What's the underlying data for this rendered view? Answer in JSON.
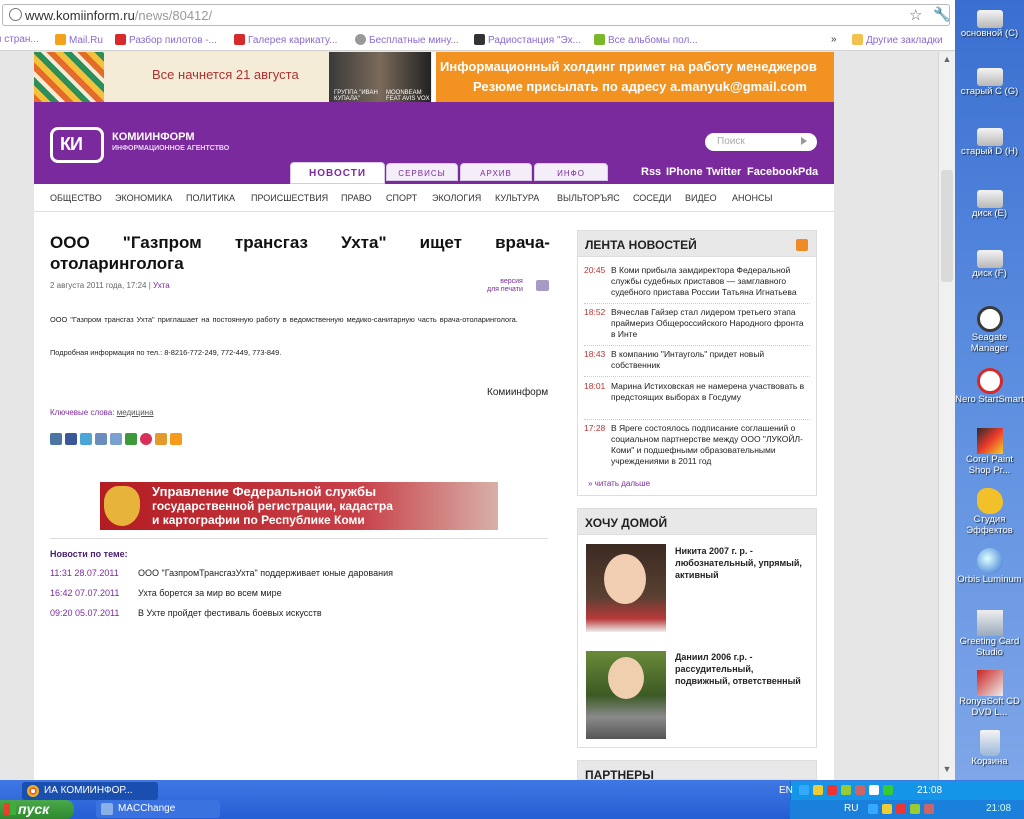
{
  "browser": {
    "url_host": "www.komiinform.ru",
    "url_path": "/news/80412/",
    "bookmarks": [
      {
        "label": "я стран..."
      },
      {
        "label": "Mail.Ru"
      },
      {
        "label": "Разбор пилотов -..."
      },
      {
        "label": "Галерея карикату..."
      },
      {
        "label": "Бесплатные мину..."
      },
      {
        "label": "Радиостанция \"Эх..."
      },
      {
        "label": "Все альбомы пол..."
      }
    ],
    "bookmarks_more": "»",
    "other_bookmarks": "Другие закладки"
  },
  "banners": {
    "top_left_text": "Все начнется 21 августа",
    "top_left_label1": "ГРУППА \"ИВАН КУПАЛА\"",
    "top_left_label2": "MOONBEAM FEAT AVIS VOX",
    "top_right_line1": "Информационный холдинг примет на работу менеджеров",
    "top_right_line2": "Резюме присылать по адресу a.manyuk@gmail.com",
    "mid_line1": "Управление Федеральной службы",
    "mid_line2": "государственной регистрации, кадастра",
    "mid_line3": "и картографии по Республике Коми"
  },
  "header": {
    "logo_text": "КИ",
    "brand": "КОМИИНФОРМ",
    "brand_sub": "ИНФОРМАЦИОННОЕ АГЕНТСТВО",
    "search_placeholder": "Поиск",
    "tabs": [
      "НОВОСТИ",
      "СЕРВИСЫ",
      "АРХИВ",
      "ИНФО"
    ],
    "links": [
      "Rss",
      "IPhone",
      "Twitter",
      "Facebook",
      "Pda"
    ]
  },
  "nav": [
    "ОБЩЕСТВО",
    "ЭКОНОМИКА",
    "ПОЛИТИКА",
    "ПРОИСШЕСТВИЯ",
    "ПРАВО",
    "СПОРТ",
    "ЭКОЛОГИЯ",
    "КУЛЬТУРА",
    "ВЫЛЬТОРЪЯС",
    "СОСЕДИ",
    "ВИДЕО",
    "АНОНСЫ"
  ],
  "article": {
    "title_w1": "ООО",
    "title_w2": "\"Газпром",
    "title_w3": "трансгаз",
    "title_w4": "Ухта\"",
    "title_w5": "ищет",
    "title_w6": "врача-",
    "title_line2": "отоларинголога",
    "date": "2 августа 2011 года, 17:24 |",
    "place": "Ухта",
    "print_label_1": "версия",
    "print_label_2": "для печати",
    "para1": "ООО \"Газпром трансгаз Ухта\" приглашает на постоянную работу в ведомственную медико-санитарную часть врача-отоларинголога.",
    "para2": "Подробная информация по тел.: 8-8216-772-249, 772-449, 773-849.",
    "source": "Коми­информ",
    "keywords_label": "Ключевые слова:",
    "keywords_value": "медицина"
  },
  "related": {
    "heading": "Новости по теме:",
    "items": [
      {
        "time": "11:31 28.07.2011",
        "text": "ООО \"ГазпромТрансгазУхта\" поддерживает юные дарования"
      },
      {
        "time": "16:42 07.07.2011",
        "text": "Ухта борется за мир во всем мире"
      },
      {
        "time": "09:20 05.07.2011",
        "text": "В Ухте пройдет фестиваль боевых искусств"
      }
    ]
  },
  "feed": {
    "heading": "ЛЕНТА НОВОСТЕЙ",
    "items": [
      {
        "time": "20:45",
        "text": "В Коми прибыла замдиректора Федеральной службы судебных приставов — замглавного судебного пристава России Татьяна Игнатьева"
      },
      {
        "time": "18:52",
        "text": "Вячеслав Гайзер стал лидером третьего этапа праймериз Общероссийского Народного фронта в Инте"
      },
      {
        "time": "18:43",
        "text": "В компанию \"Интауголь\" придет новый собственник"
      },
      {
        "time": "18:01",
        "text": "Марина Истиховская не намерена участвовать в предстоящих выборах в Госдуму"
      },
      {
        "time": "17:28",
        "text": "В Яреге состоялось подписание соглашений о социальном партнерстве между ООО \"ЛУКОЙЛ-Коми\" и подшефными образовательными учреждениями в 2011 год"
      }
    ],
    "more": "» читать дальше"
  },
  "home": {
    "heading": "ХОЧУ ДОМОЙ",
    "kids": [
      {
        "text": "Никита 2007 г. р. - любознательный, упрямый, активный"
      },
      {
        "text": "Даниил 2006 г.р. - рассудительный, подвижный, ответственный"
      }
    ]
  },
  "partners": {
    "heading": "ПАРТНЕРЫ"
  },
  "desktop": {
    "icons": [
      {
        "label": "основной (C)"
      },
      {
        "label": "старый C (G)"
      },
      {
        "label": "старый D (H)"
      },
      {
        "label": "диск (E)"
      },
      {
        "label": "диск (F)"
      },
      {
        "label": "Seagate Manager"
      },
      {
        "label": "Nero StartSmart"
      },
      {
        "label": "Corel Paint Shop Pr..."
      },
      {
        "label": "Студия Эффектов"
      },
      {
        "label": "Orbis Luminum"
      },
      {
        "label": "Greeting Card Studio"
      },
      {
        "label": "RonyaSoft CD DVD L..."
      },
      {
        "label": "Корзина"
      }
    ]
  },
  "taskbar": {
    "start": "пуск",
    "buttons": [
      {
        "label": "ИА КОМИИНФОР..."
      },
      {
        "label": "MACChange"
      }
    ],
    "lang1": "EN",
    "lang2": "RU",
    "clock1": "21:08",
    "clock2": "21:08"
  },
  "colors": {
    "brand_purple": "#7b2a9e",
    "banner_orange": "#f29220",
    "time_red": "#b33333"
  }
}
